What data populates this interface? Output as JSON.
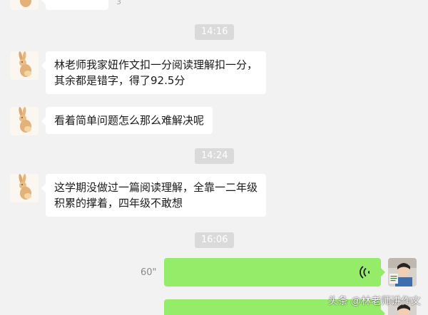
{
  "colors": {
    "background": "#f2f2f2",
    "incoming_bubble": "#ffffff",
    "outgoing_voice": "#95ec69",
    "timestamp_bg": "#dadada"
  },
  "top_partial": {
    "read_mark": "3"
  },
  "timestamps": [
    "14:16",
    "14:24",
    "16:06"
  ],
  "messages": [
    {
      "lines": [
        "林老师我家妞作文扣一分阅读理解扣一分，",
        "其余都是错字，得了92.5分"
      ]
    },
    {
      "lines": [
        "看着简单问题怎么那么难解决呢"
      ]
    },
    {
      "lines": [
        "这学期没做过一篇阅读理解，全靠一二年级",
        "积累的撑着，四年级不敢想"
      ]
    }
  ],
  "voice_message": {
    "duration": "60\"",
    "icon": "voice-wave-icon"
  },
  "watermark": "头条 @林老师讲作文"
}
